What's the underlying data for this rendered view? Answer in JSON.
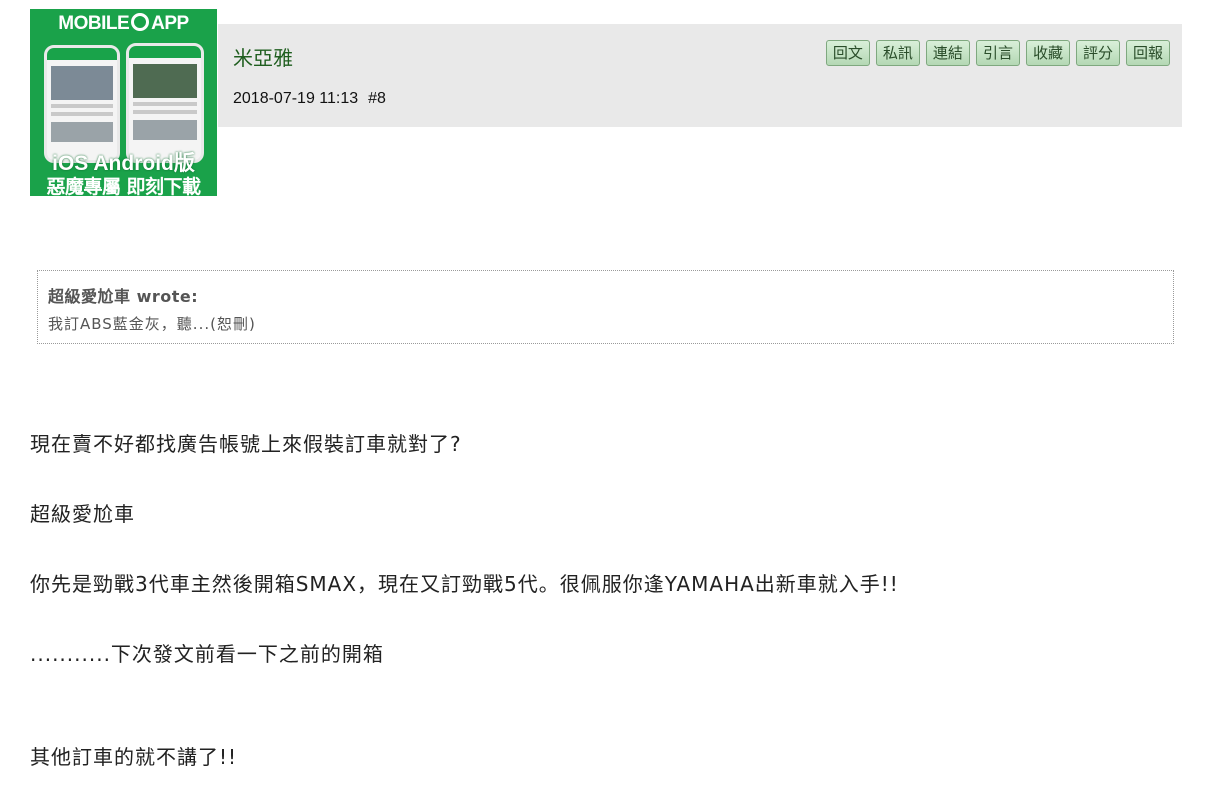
{
  "banner": {
    "title_left": "MOBILE",
    "title_right": "APP",
    "os": "iOS Android版",
    "cta": "惡魔專屬 即刻下載"
  },
  "post": {
    "author": "米亞雅",
    "datetime": "2018-07-19 11:13",
    "floor": "#8",
    "actions": [
      "回文",
      "私訊",
      "連結",
      "引言",
      "收藏",
      "評分",
      "回報"
    ]
  },
  "quote": {
    "author": "超級愛尬車 wrote:",
    "text": "我訂ABS藍金灰，聽...(恕刪)"
  },
  "body": {
    "line1": "現在賣不好都找廣告帳號上來假裝訂車就對了?",
    "line2": "超級愛尬車",
    "line3": "你先是勁戰3代車主然後開箱SMAX，現在又訂勁戰5代。很佩服你逢YAMAHA出新車就入手!!",
    "line4": "...........下次發文前看一下之前的開箱",
    "line5": "其他訂車的就不講了!!"
  },
  "colors": {
    "banner_green": "#1aa24a",
    "header_bg": "#e9e9e9",
    "author_green": "#1f5e1f",
    "button_green": "#b4d8b4"
  }
}
